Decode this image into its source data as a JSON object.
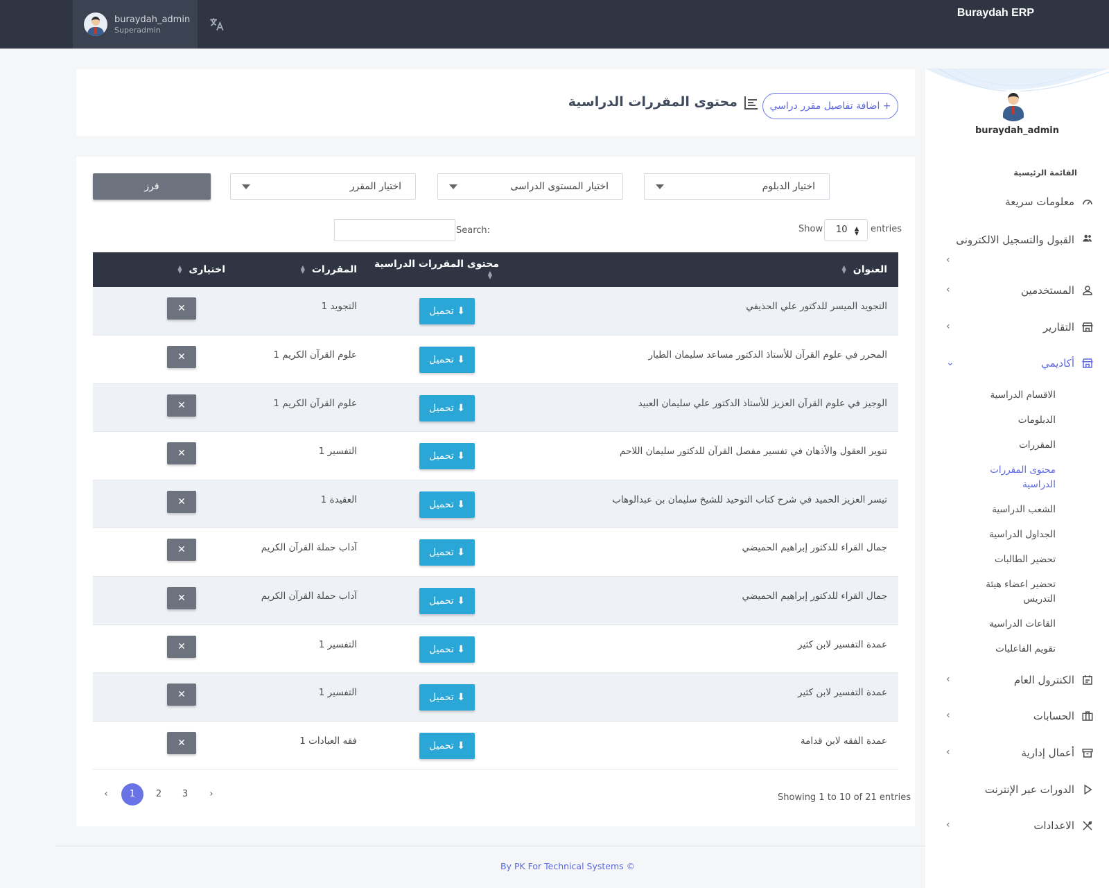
{
  "app": {
    "brand": "Buraydah ERP",
    "user_name": "buraydah_admin",
    "user_role": "Superadmin"
  },
  "header": {
    "title": "محتوى المقررات الدراسية",
    "add_button": "+ اضافة تفاصيل مقرر دراسي"
  },
  "filters": {
    "diploma": "اختيار الدبلوم",
    "level": "اختيار المستوى الدراسى",
    "course": "اختيار المقرر",
    "sort_button": "فرز"
  },
  "table_controls": {
    "show": "Show",
    "page_length": "10",
    "entries": "entries",
    "search": "Search:"
  },
  "table": {
    "headers": [
      "العنوان",
      "محتوى المقررات الدراسية",
      "المقررات",
      "اختيارى"
    ],
    "download_label": "تحميل",
    "delete_label": "✕",
    "rows": [
      {
        "title": "التجويد الميسر للدكتور علي الحذيفي",
        "course": "التجويد 1"
      },
      {
        "title": "المحرر في علوم القرآن للأستاذ الدكتور مساعد سليمان الطيار",
        "course": "علوم القرآن الكريم 1"
      },
      {
        "title": "الوجيز في علوم القرآن العزيز للأستاذ الدكتور علي سليمان العبيد",
        "course": "علوم القرآن الكريم 1"
      },
      {
        "title": "تنوير العقول والأذهان في تفسير مفصل القرآن للدكتور سليمان اللاحم",
        "course": "التفسير 1"
      },
      {
        "title": "تيسر العزيز الحميد في شرح كتاب التوحيد للشيخ سليمان بن عبدالوهاب",
        "course": "العقيدة 1"
      },
      {
        "title": "جمال القراء للدكتور إبراهيم الحميضي",
        "course": "آداب حملة القرآن الكريم"
      },
      {
        "title": "جمال القراء للدكتور إبراهيم الحميضي",
        "course": "آداب حملة القرآن الكريم"
      },
      {
        "title": "عمدة التفسير لابن كثير",
        "course": "التفسير 1"
      },
      {
        "title": "عمدة التفسير لابن كثير",
        "course": "التفسير 1"
      },
      {
        "title": "عمدة الفقه لابن قدامة",
        "course": "فقه العبادات 1"
      }
    ]
  },
  "pagination": {
    "info": "Showing 1 to 10 of 21 entries",
    "prev": "‹",
    "pages": [
      "1",
      "2",
      "3"
    ],
    "next": "›"
  },
  "sidebar": {
    "user": "buraydah_admin",
    "section": "القائمة الرئيسية",
    "items": [
      {
        "label": "معلومات سريعة",
        "icon": "speedometer-icon"
      },
      {
        "label": "القبول والتسجيل الالكترونى",
        "icon": "users-icon"
      },
      {
        "label": "المستخدمين",
        "icon": "user-icon"
      },
      {
        "label": "التقارير",
        "icon": "store-icon"
      },
      {
        "label": "أكاديمي",
        "icon": "store-icon"
      },
      {
        "label": "الكنترول العام",
        "icon": "calendar-icon"
      },
      {
        "label": "الحسابات",
        "icon": "briefcase-icon"
      },
      {
        "label": "أعمال إدارية",
        "icon": "box-icon"
      },
      {
        "label": "الدورات عبر الإنترنت",
        "icon": "play-icon"
      },
      {
        "label": "الاعدادات",
        "icon": "tools-icon"
      }
    ],
    "academic_sub": [
      "الاقسام الدراسية",
      "الدبلومات",
      "المقررات",
      "محتوى المقررات الدراسية",
      "الشعب الدراسية",
      "الجداول الدراسية",
      "تحضير الطالبات",
      "تحضير اعضاء هيئة التدريس",
      "القاعات الدراسية",
      "تقويم الفاعليات"
    ]
  },
  "footer": {
    "text": "By PK For Technical Systems ©"
  },
  "colors": {
    "topbar": "#2f3542",
    "accent": "#5b68e0",
    "download": "#2aa7d6",
    "gray_button": "#6c737e"
  }
}
